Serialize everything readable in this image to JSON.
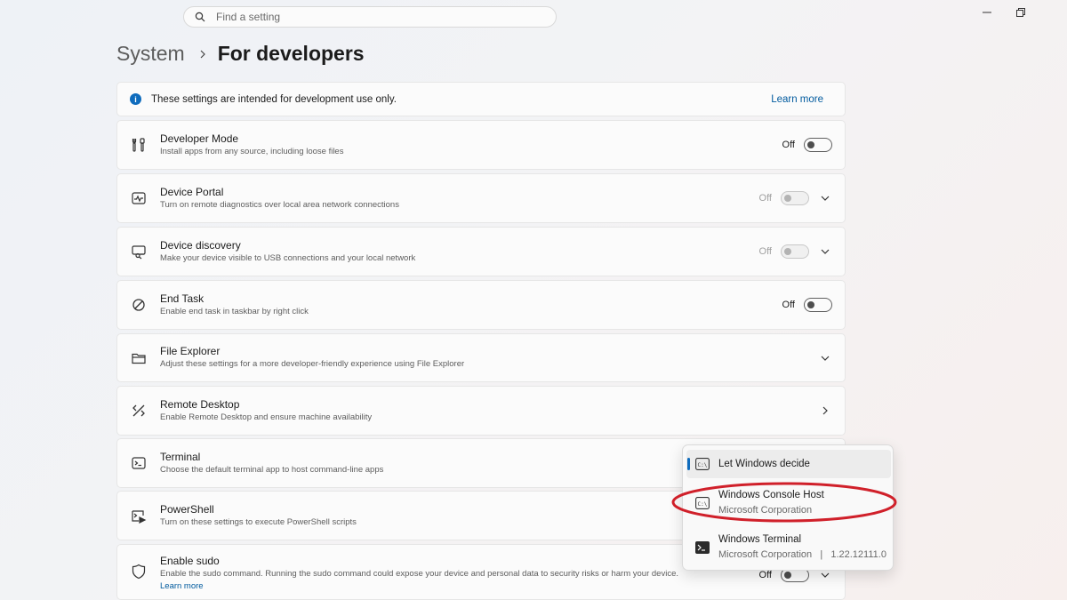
{
  "search": {
    "placeholder": "Find a setting",
    "icon": "search-icon"
  },
  "window_controls": [
    "minimize-icon",
    "restore-icon"
  ],
  "breadcrumb": {
    "parent": "System",
    "current": "For developers"
  },
  "info_bar": {
    "text": "These settings are intended for development use only.",
    "link": "Learn more"
  },
  "settings": [
    {
      "title": "Developer Mode",
      "desc": "Install apps from any source, including loose files",
      "state": "Off",
      "icon": "developer-tools-icon"
    },
    {
      "title": "Device Portal",
      "desc": "Turn on remote diagnostics over local area network connections",
      "state": "Off",
      "icon": "device-portal-icon"
    },
    {
      "title": "Device discovery",
      "desc": "Make your device visible to USB connections and your local network",
      "state": "Off",
      "icon": "device-discovery-icon"
    },
    {
      "title": "End Task",
      "desc": "Enable end task in taskbar by right click",
      "state": "Off",
      "icon": "end-task-icon"
    },
    {
      "title": "File Explorer",
      "desc": "Adjust these settings for a more developer-friendly experience using File Explorer",
      "icon": "folder-icon"
    },
    {
      "title": "Remote Desktop",
      "desc": "Enable Remote Desktop and ensure machine availability",
      "icon": "remote-desktop-icon"
    },
    {
      "title": "Terminal",
      "desc": "Choose the default terminal app to host command-line apps",
      "icon": "terminal-icon"
    },
    {
      "title": "PowerShell",
      "desc": "Turn on these settings to execute PowerShell scripts",
      "icon": "powershell-icon"
    },
    {
      "title": "Enable sudo",
      "desc": "Enable the sudo command. Running the sudo command could expose your device and personal data to security risks or harm your device.",
      "link": "Learn more",
      "state": "Off",
      "icon": "shield-icon"
    }
  ],
  "terminal_dropdown": {
    "options": [
      {
        "name": "Let Windows decide",
        "selected": true
      },
      {
        "name": "Windows Console Host",
        "publisher": "Microsoft Corporation"
      },
      {
        "name": "Windows Terminal",
        "publisher": "Microsoft Corporation   |   1.22.12111.0"
      }
    ]
  },
  "colors": {
    "accent": "#0f6cbd",
    "link": "#005a9e",
    "annotation": "#d0202a"
  }
}
